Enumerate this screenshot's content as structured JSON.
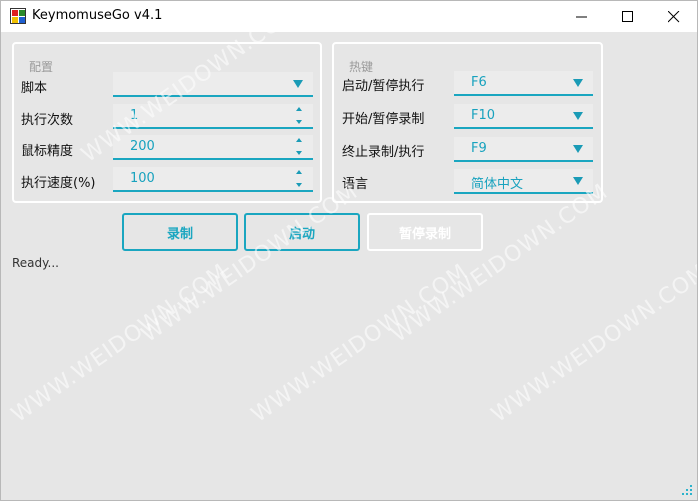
{
  "window": {
    "title": "KeymomuseGo v4.1"
  },
  "config_group": {
    "title": "配置",
    "script_label": "脚本",
    "script_value": "",
    "repeat_label": "执行次数",
    "repeat_value": "1",
    "precision_label": "鼠标精度",
    "precision_value": "200",
    "speed_label": "执行速度(%)",
    "speed_value": "100"
  },
  "hotkey_group": {
    "title": "热键",
    "start_pause_exec_label": "启动/暂停执行",
    "start_pause_exec_value": "F6",
    "start_pause_record_label": "开始/暂停录制",
    "start_pause_record_value": "F10",
    "stop_label": "终止录制/执行",
    "stop_value": "F9",
    "language_label": "语言",
    "language_value": "简体中文"
  },
  "buttons": {
    "record": "录制",
    "start": "启动",
    "pause_record": "暂停录制"
  },
  "status": "Ready...",
  "watermark": "WWW.WEIDOWN.COM",
  "colors": {
    "accent": "#1aa6c0",
    "background": "#e6e6e6"
  }
}
